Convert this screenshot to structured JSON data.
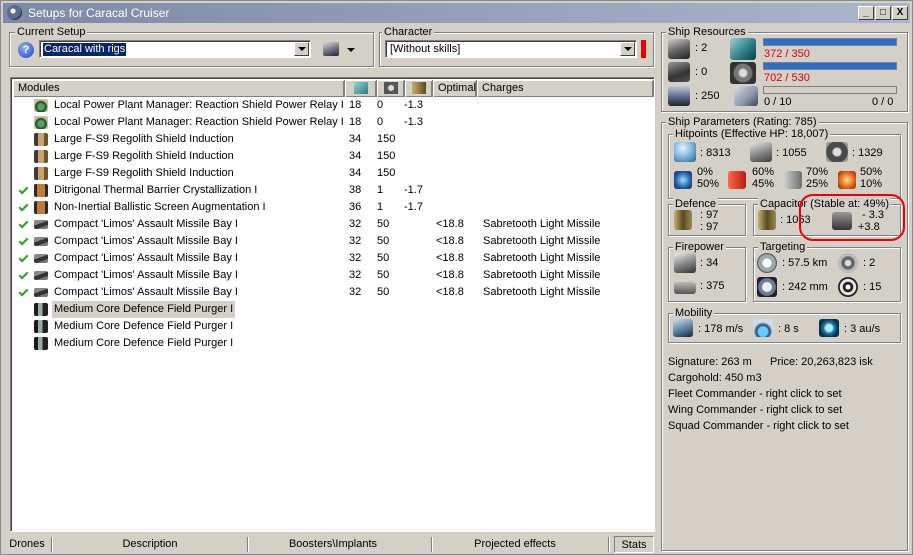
{
  "window": {
    "title": "Setups for Caracal Cruiser",
    "buttons": [
      "_",
      "□",
      "X"
    ]
  },
  "current_setup": {
    "label": "Current Setup",
    "value": "Caracal with rigs"
  },
  "character": {
    "label": "Character",
    "value": "[Without skills]"
  },
  "modules": {
    "headers": {
      "name": "Modules",
      "optimal": "Optimal",
      "charges": "Charges"
    },
    "header_icons": [
      "cpu-icon",
      "powergrid-icon",
      "capacitor-icon"
    ],
    "rows": [
      {
        "checked": false,
        "icon": "relay-icon",
        "name": "Local Power Plant Manager: Reaction Shield Power Relay I",
        "cpu": "18",
        "pg": "0",
        "cap": "-1.3",
        "optimal": "",
        "charge": ""
      },
      {
        "checked": false,
        "icon": "relay-icon",
        "name": "Local Power Plant Manager: Reaction Shield Power Relay I",
        "cpu": "18",
        "pg": "0",
        "cap": "-1.3",
        "optimal": "",
        "charge": ""
      },
      {
        "checked": false,
        "icon": "shield-extender-icon",
        "name": "Large F-S9 Regolith Shield Induction",
        "cpu": "34",
        "pg": "150",
        "cap": "",
        "optimal": "",
        "charge": ""
      },
      {
        "checked": false,
        "icon": "shield-extender-icon",
        "name": "Large F-S9 Regolith Shield Induction",
        "cpu": "34",
        "pg": "150",
        "cap": "",
        "optimal": "",
        "charge": ""
      },
      {
        "checked": false,
        "icon": "shield-extender-icon",
        "name": "Large F-S9 Regolith Shield Induction",
        "cpu": "34",
        "pg": "150",
        "cap": "",
        "optimal": "",
        "charge": ""
      },
      {
        "checked": true,
        "icon": "armor-rig-icon",
        "name": "Ditrigonal Thermal Barrier Crystallization I",
        "cpu": "38",
        "pg": "1",
        "cap": "-1.7",
        "optimal": "",
        "charge": ""
      },
      {
        "checked": true,
        "icon": "armor-rig-icon",
        "name": "Non-Inertial Ballistic Screen Augmentation I",
        "cpu": "36",
        "pg": "1",
        "cap": "-1.7",
        "optimal": "",
        "charge": ""
      },
      {
        "checked": true,
        "icon": "launcher-icon",
        "name": "Compact 'Limos' Assault Missile Bay I",
        "cpu": "32",
        "pg": "50",
        "cap": "",
        "optimal": "<18.8",
        "charge": "Sabretooth Light Missile"
      },
      {
        "checked": true,
        "icon": "launcher-icon",
        "name": "Compact 'Limos' Assault Missile Bay I",
        "cpu": "32",
        "pg": "50",
        "cap": "",
        "optimal": "<18.8",
        "charge": "Sabretooth Light Missile"
      },
      {
        "checked": true,
        "icon": "launcher-icon",
        "name": "Compact 'Limos' Assault Missile Bay I",
        "cpu": "32",
        "pg": "50",
        "cap": "",
        "optimal": "<18.8",
        "charge": "Sabretooth Light Missile"
      },
      {
        "checked": true,
        "icon": "launcher-icon",
        "name": "Compact 'Limos' Assault Missile Bay I",
        "cpu": "32",
        "pg": "50",
        "cap": "",
        "optimal": "<18.8",
        "charge": "Sabretooth Light Missile"
      },
      {
        "checked": true,
        "icon": "launcher-icon",
        "name": "Compact 'Limos' Assault Missile Bay I",
        "cpu": "32",
        "pg": "50",
        "cap": "",
        "optimal": "<18.8",
        "charge": "Sabretooth Light Missile"
      },
      {
        "checked": false,
        "icon": "purger-icon",
        "name": "Medium Core Defence Field Purger I",
        "cpu": "",
        "pg": "",
        "cap": "",
        "optimal": "",
        "charge": "",
        "selected": true
      },
      {
        "checked": false,
        "icon": "purger-icon",
        "name": "Medium Core Defence Field Purger I",
        "cpu": "",
        "pg": "",
        "cap": "",
        "optimal": "",
        "charge": ""
      },
      {
        "checked": false,
        "icon": "purger-icon",
        "name": "Medium Core Defence Field Purger I",
        "cpu": "",
        "pg": "",
        "cap": "",
        "optimal": "",
        "charge": ""
      }
    ]
  },
  "bottom_tabs": [
    "Drones",
    "Description",
    "Boosters\\Implants",
    "Projected effects",
    "Stats"
  ],
  "ship_resources": {
    "label": "Ship Resources",
    "turret_slots": ": 2",
    "launcher_slots": ": 0",
    "calibration": ": 250",
    "cpu": "372 / 350",
    "cpu_fill": 1.0,
    "powergrid": "702 / 530",
    "pg_fill": 1.0,
    "drone_bay": "0 / 10",
    "drone_bw": "0 / 0",
    "accent": "#2e6fc9",
    "overload_color": "#e00000"
  },
  "ship_params": {
    "label": "Ship Parameters (Rating: 785)",
    "hitpoints": {
      "label": "Hitpoints (Effective HP: 18,007)",
      "shield": ": 8313",
      "armor": ": 1055",
      "hull": ": 1329",
      "em": [
        "0%",
        "50%"
      ],
      "thermal": [
        "60%",
        "45%"
      ],
      "kinetic": [
        "70%",
        "25%"
      ],
      "explosive": [
        "50%",
        "10%"
      ]
    },
    "defence": {
      "label": "Defence",
      "v1": ": 97",
      "v2": ": 97"
    },
    "capacitor": {
      "label": "Capacitor (Stable at: 49%)",
      "amount": ": 1063",
      "v1": "- 3.3",
      "v2": "+3.8"
    },
    "firepower": {
      "label": "Firepower",
      "turret": ": 34",
      "missile": ": 375"
    },
    "targeting": {
      "label": "Targeting",
      "range": ": 57.5 km",
      "targets": ": 2",
      "scan": ": 242 mm",
      "sensor": ": 15"
    },
    "mobility": {
      "label": "Mobility",
      "velocity": ": 178 m/s",
      "align": ": 8 s",
      "warp": ": 3 au/s"
    },
    "signature": "Signature: 263 m",
    "price": "Price: 20,263,823 isk",
    "cargohold": "Cargohold: 450 m3",
    "fleet": "Fleet Commander - right click to set",
    "wing": "Wing Commander - right click to set",
    "squad": "Squad Commander - right click to set"
  }
}
